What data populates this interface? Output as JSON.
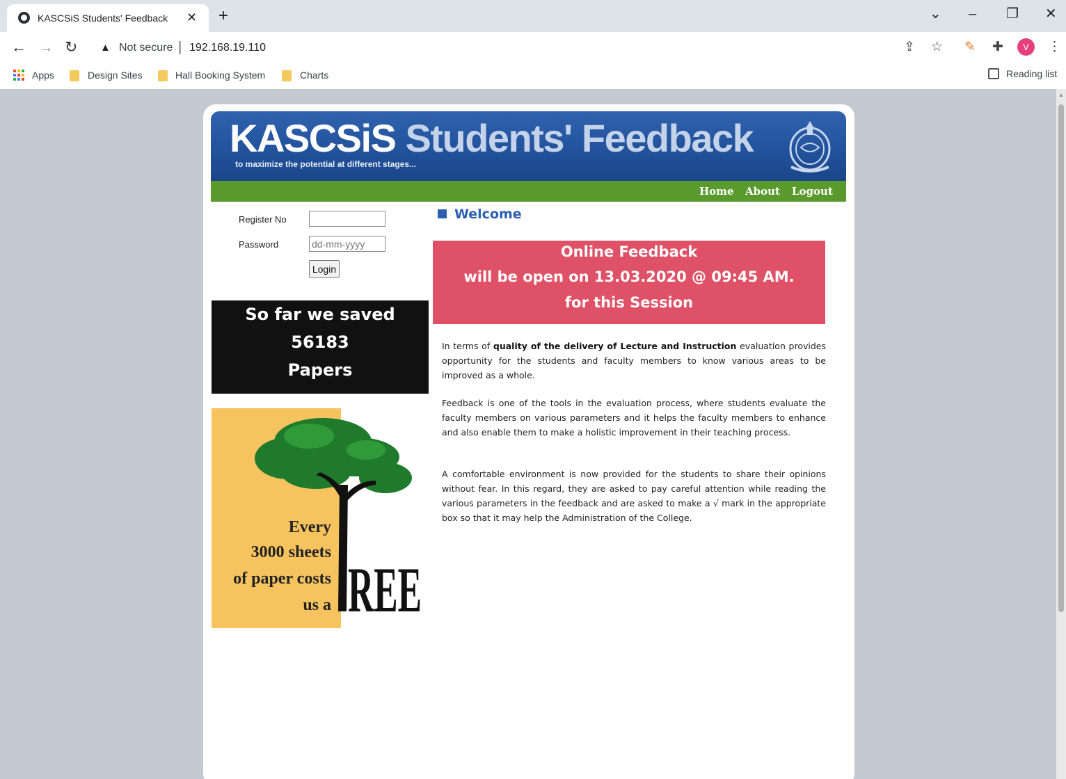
{
  "browser": {
    "tab_title": "KASCSiS Students' Feedback",
    "tab_close": "✕",
    "new_tab": "+",
    "security_label": "Not secure",
    "url": "192.168.19.110",
    "profile_initial": "V",
    "bookmarks": [
      {
        "label": "Apps",
        "icon": "apps-grid-icon"
      },
      {
        "label": "Design Sites",
        "icon": "folder-icon"
      },
      {
        "label": "Hall Booking System",
        "icon": "folder-icon"
      },
      {
        "label": "Charts",
        "icon": "folder-icon"
      }
    ],
    "reading_list": "Reading list",
    "icons": [
      "back-icon",
      "forward-icon",
      "reload-icon",
      "warning-icon",
      "share-icon",
      "star-icon",
      "extension-puzzle-icon",
      "menu-dots-icon",
      "minimize-icon",
      "maximize-icon",
      "close-icon"
    ]
  },
  "site": {
    "title_part1": "KASCSiS",
    "title_part2": "Students' Feedback",
    "tagline": "to maximize the potential at different stages...",
    "nav": [
      {
        "label": "Home"
      },
      {
        "label": "About"
      },
      {
        "label": "Logout"
      }
    ],
    "colors": {
      "header": "#21519b",
      "nav": "#5a9a2c",
      "notice": "#de5166",
      "accent": "#2c60b0"
    }
  },
  "login": {
    "register_label": "Register No",
    "register_value": "",
    "password_label": "Password",
    "password_placeholder": "dd-mm-yyyy",
    "button": "Login"
  },
  "saved": {
    "line1": "So far we saved",
    "count": "56183",
    "line3": "Papers"
  },
  "poster": {
    "text_lines": [
      "Every",
      "3000 sheets",
      "of paper costs",
      "us a"
    ],
    "big_word": "REE"
  },
  "content": {
    "welcome": "Welcome",
    "notice": [
      "Online Feedback",
      "will be open on 13.03.2020 @ 09:45 AM.",
      "for this Session"
    ],
    "p1_a": "In terms of ",
    "p1_b": "quality of the delivery of Lecture and Instruction",
    "p1_c": " evaluation provides opportunity for the students and faculty members to know various areas to be improved as a whole.",
    "p2": "Feedback is one of the tools in the evaluation process, where students evaluate the faculty members on various parameters and it helps the faculty members to enhance and also enable them to make a holistic improvement in their teaching process.",
    "p3": "A comfortable environment is now provided for the students to share their opinions without fear. In this regard, they are asked to pay careful attention while reading the various parameters in the feedback and are asked to make a √ mark in the appropriate box so that it may help the Administration of the College."
  }
}
